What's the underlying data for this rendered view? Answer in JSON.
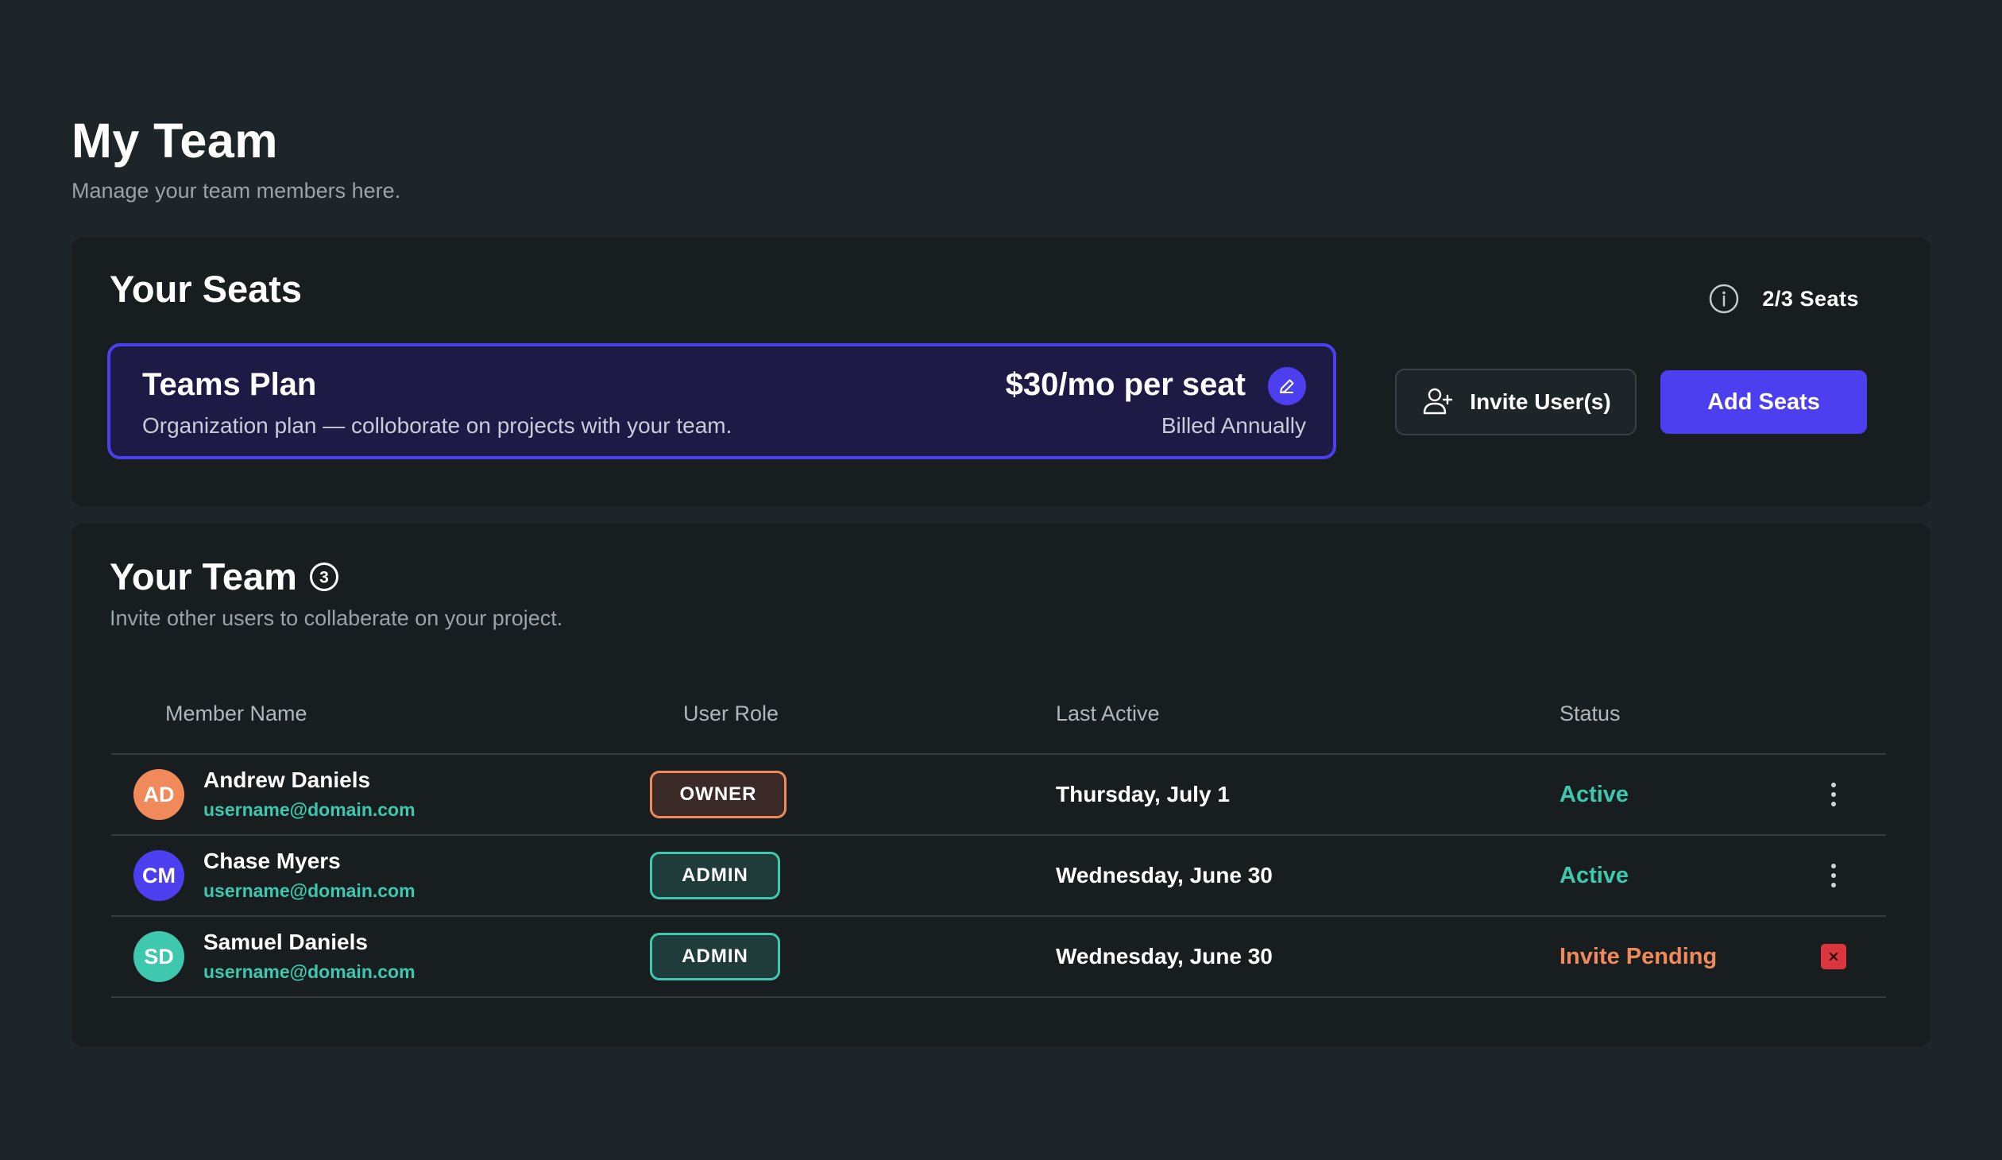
{
  "header": {
    "title": "My Team",
    "subtitle": "Manage your team members here."
  },
  "seats": {
    "title": "Your Seats",
    "count_label": "2/3 Seats",
    "info_icon": "info-icon",
    "plan": {
      "name": "Teams Plan",
      "description": "Organization plan — colloborate on projects with your team.",
      "price": "$30/mo per seat",
      "billing": "Billed Annually",
      "edit_icon": "pencil-icon"
    },
    "invite_button": "Invite User(s)",
    "invite_icon": "user-plus-icon",
    "add_seats_button": "Add Seats"
  },
  "team": {
    "title": "Your Team",
    "count_icon": "circled-number-3-icon",
    "subtitle": "Invite other users to collaberate on your project.",
    "columns": [
      "Member Name",
      "User Role",
      "Last Active",
      "Status"
    ],
    "members": [
      {
        "initials": "AD",
        "name": "Andrew Daniels",
        "email": "username@domain.com",
        "role": "OWNER",
        "last_active": "Thursday, July 1",
        "status": "Active",
        "avatar_color": "#f08a5b",
        "action": "more-options-icon"
      },
      {
        "initials": "CM",
        "name": "Chase Myers",
        "email": "username@domain.com",
        "role": "ADMIN",
        "last_active": "Wednesday, June 30",
        "status": "Active",
        "avatar_color": "#4c3ff0",
        "action": "more-options-icon"
      },
      {
        "initials": "SD",
        "name": "Samuel Daniels",
        "email": "username@domain.com",
        "role": "ADMIN",
        "last_active": "Wednesday, June 30",
        "status": "Invite Pending",
        "avatar_color": "#3ec8ad",
        "action": "remove-icon"
      }
    ]
  },
  "colors": {
    "background": "#1e2528",
    "panel": "#181d20",
    "accent": "#4c3ff0",
    "teal": "#3ec8ad",
    "orange": "#f08a5b",
    "danger": "#d9363e"
  }
}
